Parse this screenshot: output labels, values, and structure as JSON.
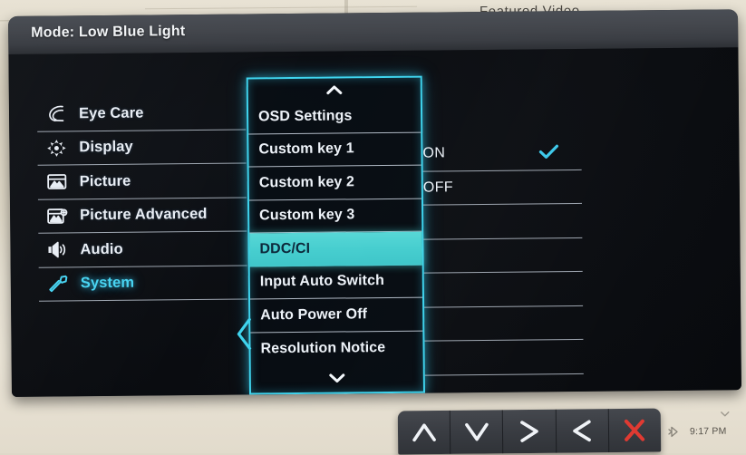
{
  "background": {
    "featured_video_label": "Featured Video",
    "desk_color": "#ded8c8"
  },
  "monitor": {
    "mode_bar": {
      "label": "Mode: Low Blue Light"
    },
    "osd": {
      "accent_color": "#3fd4ee",
      "highlight_color": "#4acfd0",
      "sidebar": {
        "items": [
          {
            "label": "Eye Care",
            "icon": "eye-care-icon",
            "active": false
          },
          {
            "label": "Display",
            "icon": "display-icon",
            "active": false
          },
          {
            "label": "Picture",
            "icon": "picture-icon",
            "active": false
          },
          {
            "label": "Picture Advanced",
            "icon": "picture-advanced-icon",
            "active": false
          },
          {
            "label": "Audio",
            "icon": "audio-icon",
            "active": false
          },
          {
            "label": "System",
            "icon": "wrench-icon",
            "active": true
          }
        ]
      },
      "menu": {
        "scroll_up_icon": "chevron-up-icon",
        "scroll_down_icon": "chevron-down-icon",
        "selected": "DDC/CI",
        "pointer_at": "Input Auto Switch",
        "items": [
          {
            "label": "OSD Settings",
            "selected": false
          },
          {
            "label": "Custom key 1",
            "selected": false
          },
          {
            "label": "Custom key 2",
            "selected": false
          },
          {
            "label": "Custom key 3",
            "selected": false
          },
          {
            "label": "DDC/CI",
            "selected": true
          },
          {
            "label": "Input Auto Switch",
            "selected": false
          },
          {
            "label": "Auto Power Off",
            "selected": false
          },
          {
            "label": "Resolution Notice",
            "selected": false
          }
        ]
      },
      "values": {
        "checked": "ON",
        "check_icon": "checkmark-icon",
        "rows": [
          {
            "label": "ON",
            "checked": true
          },
          {
            "label": "OFF",
            "checked": false
          },
          {
            "label": "",
            "checked": false
          },
          {
            "label": "",
            "checked": false
          },
          {
            "label": "",
            "checked": false
          },
          {
            "label": "",
            "checked": false
          },
          {
            "label": "",
            "checked": false
          }
        ]
      }
    }
  },
  "keybar": {
    "buttons": [
      {
        "name": "up-button",
        "icon": "chevron-up-icon",
        "glyph": "∧",
        "color": "#f0f3f7"
      },
      {
        "name": "down-button",
        "icon": "chevron-down-icon",
        "glyph": "∨",
        "color": "#f0f3f7"
      },
      {
        "name": "right-button",
        "icon": "chevron-right-icon",
        "glyph": ">",
        "color": "#f0f3f7"
      },
      {
        "name": "left-button",
        "icon": "chevron-left-icon",
        "glyph": "<",
        "color": "#f0f3f7"
      },
      {
        "name": "exit-button",
        "icon": "close-x-icon",
        "glyph": "✕",
        "color": "#e03a32"
      }
    ]
  },
  "taskbar": {
    "time": "9:17 PM",
    "tray_icon": "bluetooth-tray-icon",
    "overflow_icon": "show-hidden-icons-arrow"
  }
}
